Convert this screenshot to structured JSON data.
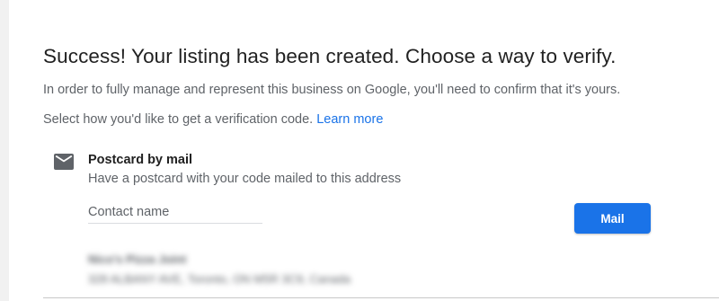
{
  "header": {
    "title": "Success! Your listing has been created. Choose a way to verify.",
    "description": "In order to fully manage and represent this business on Google, you'll need to confirm that it's yours.",
    "select_text": "Select how you'd like to get a verification code.",
    "learn_more": "Learn more"
  },
  "option": {
    "icon": "mail-icon",
    "title": "Postcard by mail",
    "description": "Have a postcard with your code mailed to this address",
    "contact_placeholder": "Contact name",
    "contact_value": "",
    "button_label": "Mail"
  },
  "address": {
    "name": "Nico's Pizza Joint",
    "line": "328 ALBANY AVE, Toronto, ON M5R 3C9, Canada"
  },
  "colors": {
    "accent": "#1a73e8",
    "text_primary": "#212121",
    "text_secondary": "#5f6368"
  }
}
